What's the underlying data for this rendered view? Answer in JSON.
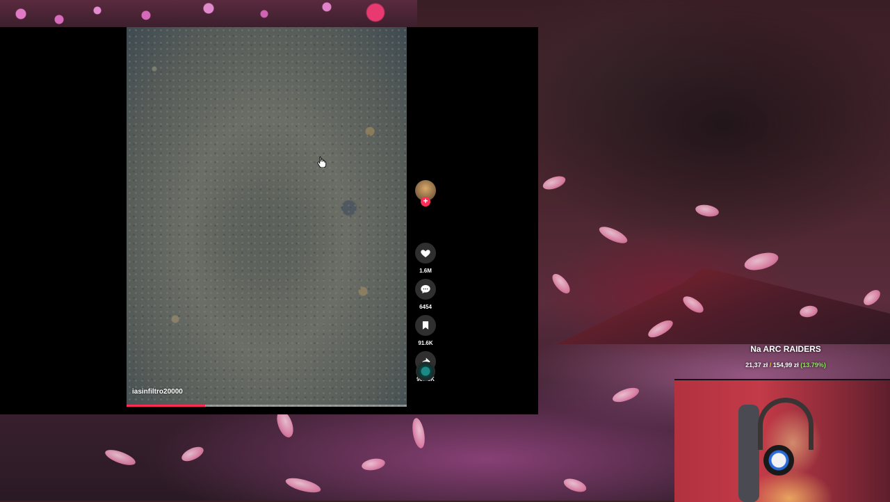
{
  "video": {
    "username": "iasinfiltro20000",
    "progress_percent": 28
  },
  "actions": {
    "likes": "1.6M",
    "comments": "6454",
    "saves": "91.6K",
    "shares": "902.3K"
  },
  "overlay": {
    "goal_title": "Na ARC RAIDERS",
    "goal_current": "21,37 zł",
    "goal_separator": "/",
    "goal_target": "154,99 zł",
    "goal_percent": "(13.79%)"
  },
  "colors": {
    "accent": "#fe2c55",
    "goal_percent": "#8dea5c"
  },
  "icons": [
    "heart-icon",
    "comment-icon",
    "bookmark-icon",
    "share-icon",
    "plus-icon",
    "music-disc-icon",
    "hand-cursor-icon"
  ]
}
